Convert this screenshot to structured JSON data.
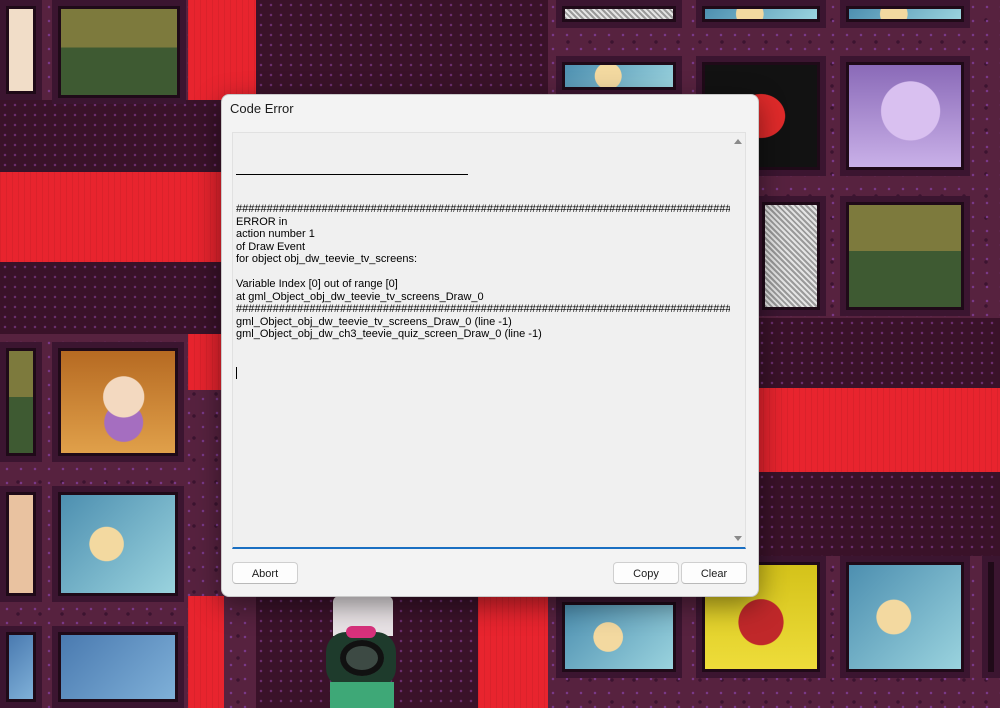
{
  "dialog": {
    "title": "Code Error",
    "error_lines": [
      "############################################################################################",
      "ERROR in",
      "action number 1",
      "of Draw Event",
      "for object obj_dw_teevie_tv_screens:",
      "",
      "Variable Index [0] out of range [0]",
      "at gml_Object_obj_dw_teevie_tv_screens_Draw_0",
      "############################################################################################",
      "gml_Object_obj_dw_teevie_tv_screens_Draw_0 (line -1)",
      "gml_Object_obj_dw_ch3_teevie_quiz_screen_Draw_0 (line -1)"
    ],
    "buttons": {
      "abort": "Abort",
      "copy": "Copy",
      "clear": "Clear"
    }
  },
  "background": {
    "description_icon": "game-scene-icon"
  }
}
